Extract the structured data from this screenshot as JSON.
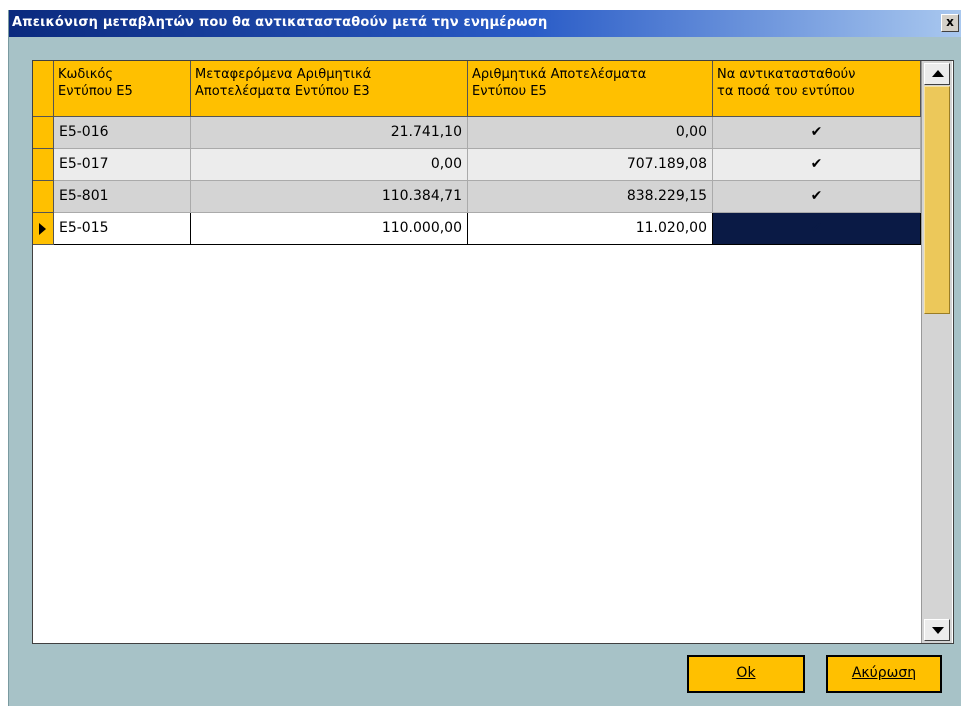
{
  "window": {
    "title": "Απεικόνιση μεταβλητών που θα αντικατασταθούν μετά την ενημέρωση",
    "close_label": "x"
  },
  "grid": {
    "columns": [
      "Κωδικός\nΕντύπου Ε5",
      "Μεταφερόμενα Αριθμητικά\nΑποτελέσματα Εντύπου Ε3",
      "Αριθμητικά Αποτελέσματα\nΕντύπου Ε5",
      "Να αντικατασταθούν\nτα ποσά του εντύπου"
    ],
    "rows": [
      {
        "code": "E5-016",
        "e3": "21.741,10",
        "e5": "0,00",
        "replace": "✔"
      },
      {
        "code": "E5-017",
        "e3": "0,00",
        "e5": "707.189,08",
        "replace": "✔"
      },
      {
        "code": "E5-801",
        "e3": "110.384,71",
        "e5": "838.229,15",
        "replace": "✔"
      },
      {
        "code": "E5-015",
        "e3": "110.000,00",
        "e5": "11.020,00",
        "replace": "✔"
      }
    ],
    "current_row": 3
  },
  "buttons": {
    "ok": "Ok",
    "cancel": "Ακύρωση"
  },
  "colors": {
    "accent": "#ffc000",
    "selection": "#0a1a45",
    "background": "#a7c2c7"
  }
}
